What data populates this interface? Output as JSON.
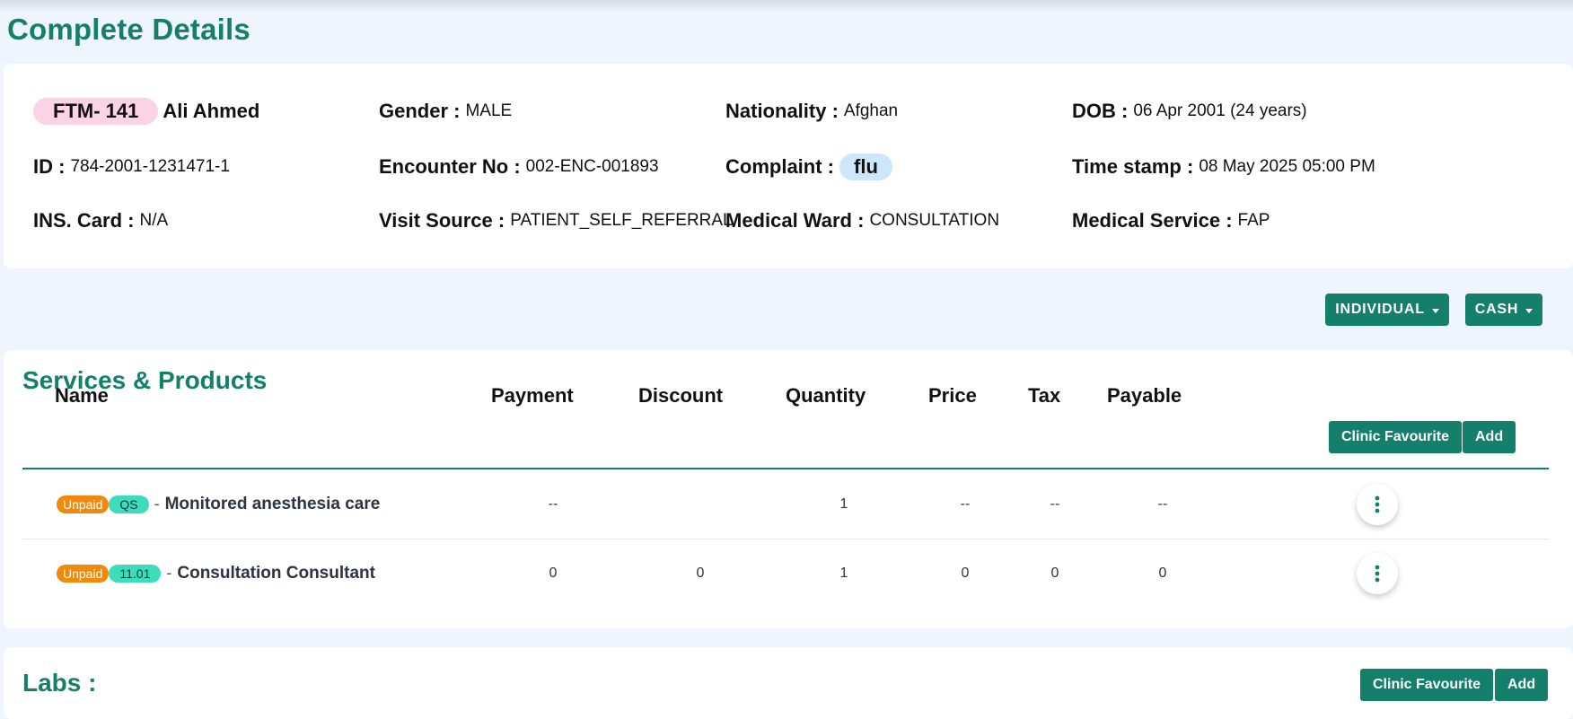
{
  "page": {
    "title": "Complete Details"
  },
  "patient": {
    "mrn": "FTM- 141",
    "name": "Ali Ahmed",
    "fields": [
      [
        {
          "label": "Gender :",
          "value": "MALE"
        },
        {
          "label": "Nationality :",
          "value": "Afghan"
        },
        {
          "label": "DOB :",
          "value": "06 Apr 2001 (24 years)"
        }
      ],
      [
        {
          "label": "ID :",
          "value": "784-2001-1231471-1"
        },
        {
          "label": "Encounter No :",
          "value": "002-ENC-001893"
        },
        {
          "label": "Complaint :",
          "value": "flu"
        },
        {
          "label": "Time stamp :",
          "value": "08 May 2025 05:00 PM"
        }
      ],
      [
        {
          "label": "INS. Card :",
          "value": "N/A"
        },
        {
          "label": "Visit Source :",
          "value": "PATIENT_SELF_REFERRAL"
        },
        {
          "label": "Medical Ward :",
          "value": "CONSULTATION"
        },
        {
          "label": "Medical Service :",
          "value": "FAP"
        }
      ]
    ]
  },
  "billing": {
    "type_label": "INDIVIDUAL",
    "payment_label": "CASH"
  },
  "services": {
    "title": "Services & Products",
    "clinic_favourite_label": "Clinic Favourite",
    "add_label": "Add",
    "columns": [
      "Name",
      "Payment",
      "Discount",
      "Quantity",
      "Price",
      "Tax",
      "Payable"
    ],
    "rows": [
      {
        "status": "Unpaid",
        "code": "QS",
        "separator": "-",
        "name": "Monitored anesthesia care",
        "payment": "--",
        "discount": "",
        "quantity": "1",
        "price": "--",
        "tax": "--",
        "payable": "--"
      },
      {
        "status": "Unpaid",
        "code": "11.01",
        "separator": "-",
        "name": "Consultation Consultant",
        "payment": "0",
        "discount": "0",
        "quantity": "1",
        "price": "0",
        "tax": "0",
        "payable": "0"
      }
    ]
  },
  "labs": {
    "title": "Labs :",
    "clinic_favourite_label": "Clinic Favourite",
    "add_label": "Add"
  },
  "colors": {
    "accent": "#147f6b",
    "page_bg": "#eef5fc",
    "unpaid": "#f0890c",
    "code_chip": "#3cdcbc",
    "mrn_badge": "#fbd3e6",
    "complaint_chip": "#cde6fb"
  }
}
